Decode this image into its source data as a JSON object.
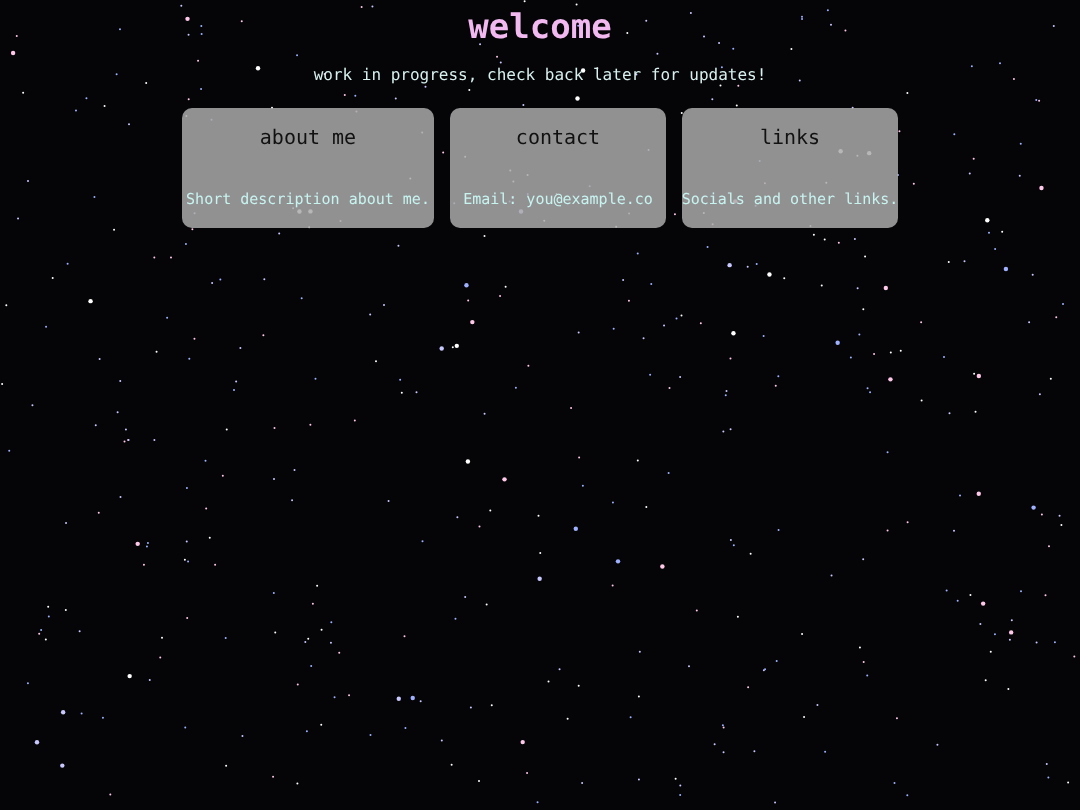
{
  "title": "welcome",
  "subtitle": "work in progress, check back later for updates!",
  "cards": [
    {
      "heading": "about me",
      "text": "Short description about me."
    },
    {
      "heading": "contact",
      "text": "Email: you@example.co"
    },
    {
      "heading": "links",
      "text": "Socials and other links."
    }
  ]
}
